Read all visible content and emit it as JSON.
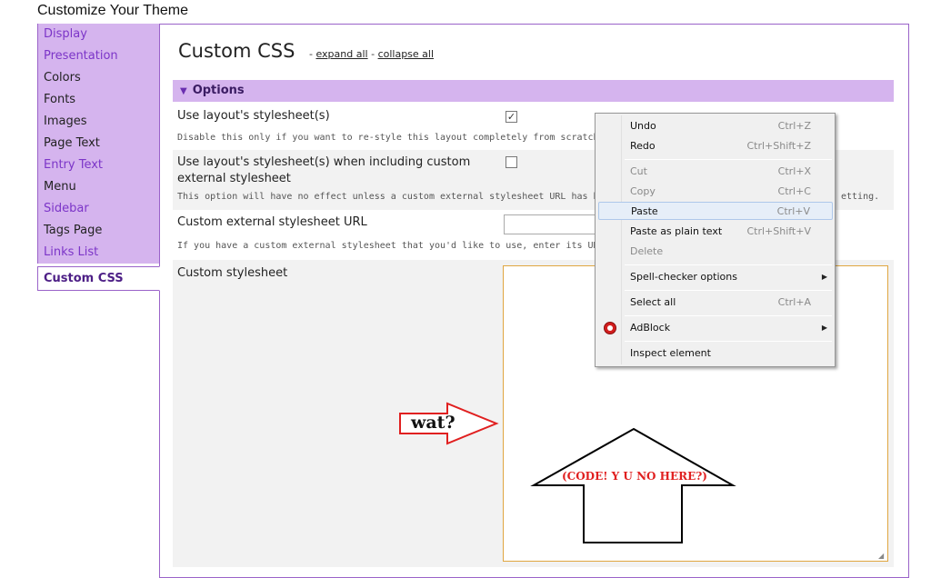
{
  "page": {
    "title": "Customize Your Theme"
  },
  "sidebar": {
    "items": [
      {
        "label": "Display",
        "link": true
      },
      {
        "label": "Presentation",
        "link": true
      },
      {
        "label": "Colors",
        "link": false
      },
      {
        "label": "Fonts",
        "link": false
      },
      {
        "label": "Images",
        "link": false
      },
      {
        "label": "Page Text",
        "link": false
      },
      {
        "label": "Entry Text",
        "link": true
      },
      {
        "label": "Menu",
        "link": false
      },
      {
        "label": "Sidebar",
        "link": true
      },
      {
        "label": "Tags Page",
        "link": false
      },
      {
        "label": "Links List",
        "link": true
      }
    ],
    "active": "Custom CSS"
  },
  "main": {
    "title": "Custom CSS",
    "expand_all": "expand all",
    "collapse_all": "collapse all",
    "options_header": "Options",
    "opt1_label": "Use layout's stylesheet(s)",
    "opt1_help": "Disable this only if you want to re-style this layout completely from scratch using a",
    "opt1_checked": true,
    "opt2_label_line1": "Use layout's stylesheet(s) when including custom",
    "opt2_label_line2": "external stylesheet",
    "opt2_help": "This option will have no effect unless a custom external stylesheet URL has been",
    "opt2_help_tail": "etting.",
    "opt2_checked": false,
    "opt3_label": "Custom external stylesheet URL",
    "opt3_help": "If you have a custom external stylesheet that you'd like to use, enter its URL here",
    "opt4_label": "Custom stylesheet"
  },
  "context_menu": {
    "items": {
      "undo": {
        "label": "Undo",
        "shortcut": "Ctrl+Z"
      },
      "redo": {
        "label": "Redo",
        "shortcut": "Ctrl+Shift+Z"
      },
      "cut": {
        "label": "Cut",
        "shortcut": "Ctrl+X"
      },
      "copy": {
        "label": "Copy",
        "shortcut": "Ctrl+C"
      },
      "paste": {
        "label": "Paste",
        "shortcut": "Ctrl+V"
      },
      "paste_plain": {
        "label": "Paste as plain text",
        "shortcut": "Ctrl+Shift+V"
      },
      "delete": {
        "label": "Delete"
      },
      "spell": {
        "label": "Spell-checker options"
      },
      "select_all": {
        "label": "Select all",
        "shortcut": "Ctrl+A"
      },
      "adblock": {
        "label": "AdBlock"
      },
      "inspect": {
        "label": "Inspect element"
      }
    }
  },
  "annotations": {
    "wat": "wat?",
    "code": "(CODE! Y U NO HERE?)"
  },
  "colors": {
    "accent": "#d5b4ee",
    "border": "#9a63c9",
    "annotation_red": "#e02020"
  }
}
